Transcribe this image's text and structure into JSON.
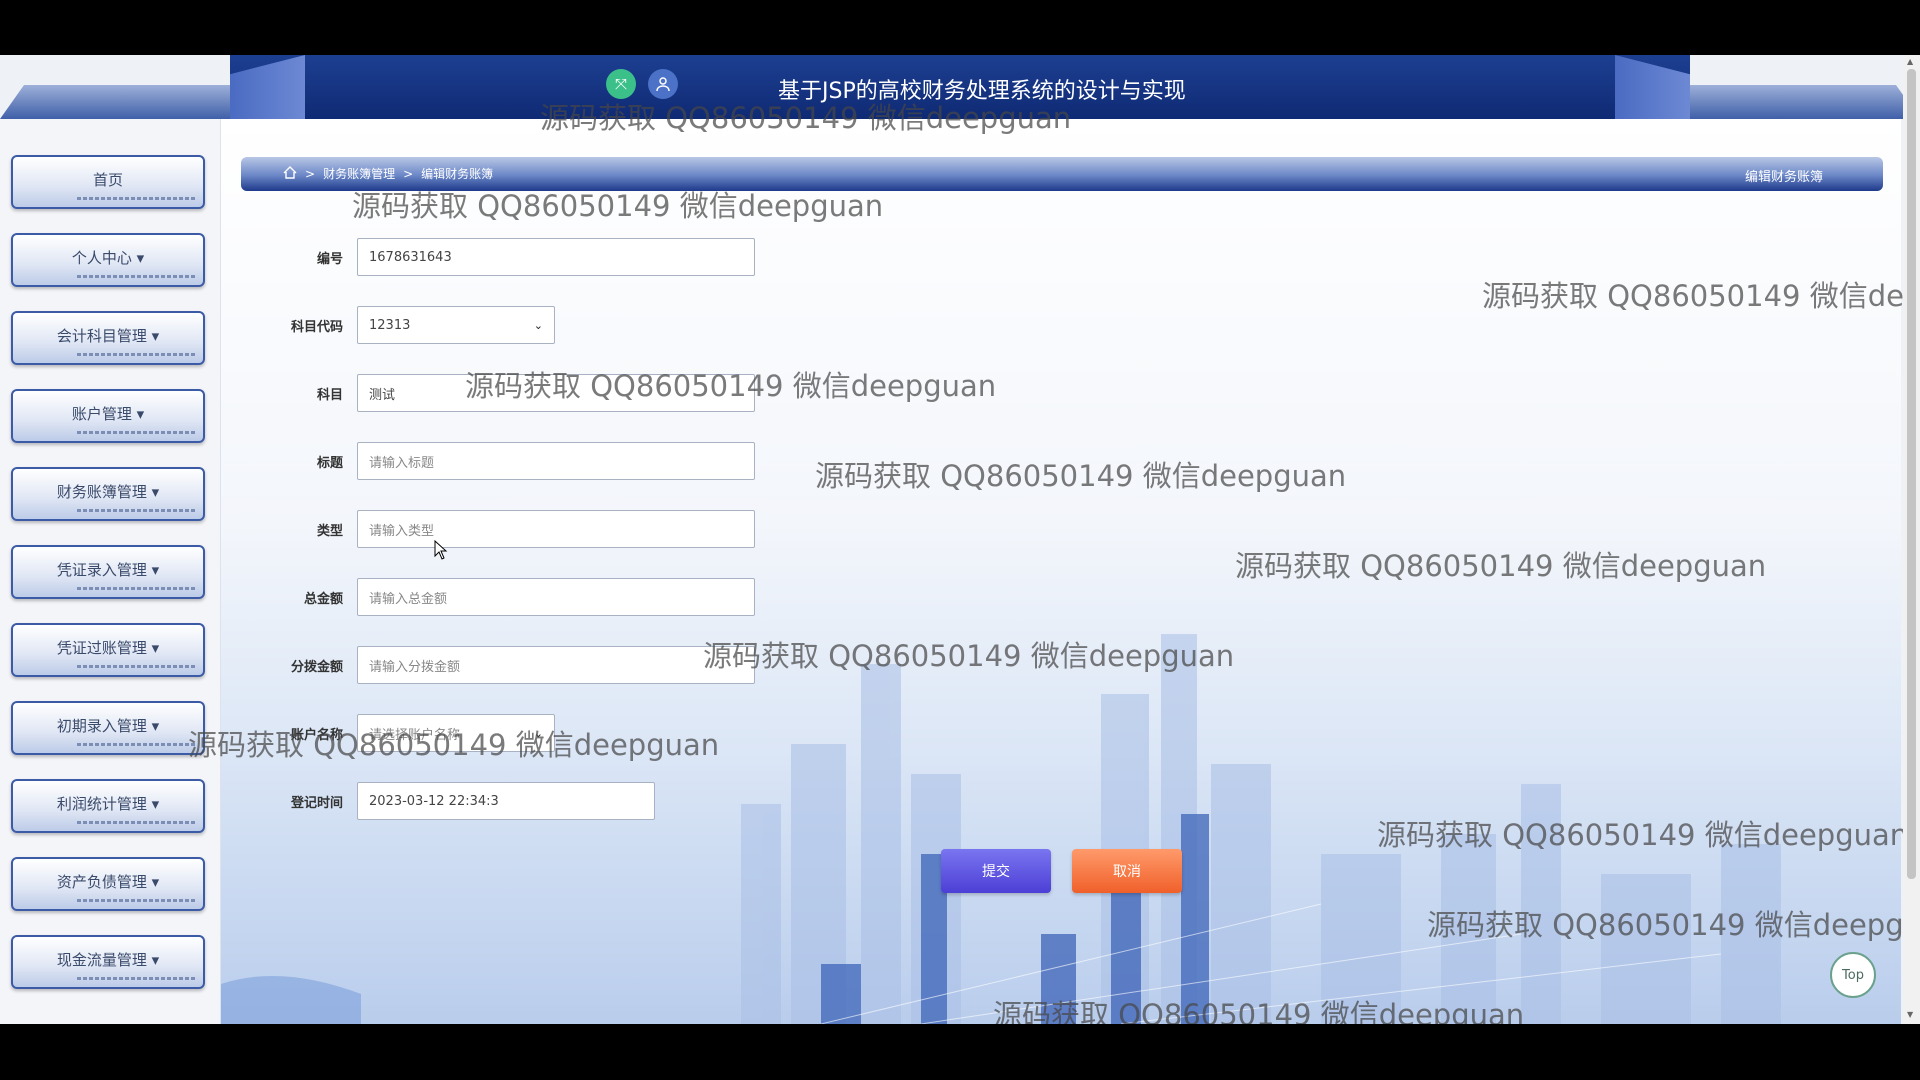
{
  "header": {
    "title": "基于JSP的高校财务处理系统的设计与实现"
  },
  "icons": {
    "fullscreen": "expand-arrows-icon",
    "user": "user-icon",
    "home": "home-icon"
  },
  "sidebar": {
    "items": [
      {
        "label": "首页"
      },
      {
        "label": "个人中心 ▾"
      },
      {
        "label": "会计科目管理 ▾"
      },
      {
        "label": "账户管理 ▾"
      },
      {
        "label": "财务账簿管理 ▾"
      },
      {
        "label": "凭证录入管理 ▾"
      },
      {
        "label": "凭证过账管理 ▾"
      },
      {
        "label": "初期录入管理 ▾"
      },
      {
        "label": "利润统计管理 ▾"
      },
      {
        "label": "资产负债管理 ▾"
      },
      {
        "label": "现金流量管理 ▾"
      }
    ]
  },
  "breadcrumb": {
    "sep": ">",
    "level1": "财务账簿管理",
    "level2": "编辑财务账簿",
    "right_title": "编辑财务账簿"
  },
  "form": {
    "id": {
      "label": "编号",
      "value": "1678631643"
    },
    "subject_code": {
      "label": "科目代码",
      "value": "12313"
    },
    "subject": {
      "label": "科目",
      "value": "测试"
    },
    "title": {
      "label": "标题",
      "placeholder": "请输入标题"
    },
    "type": {
      "label": "类型",
      "placeholder": "请输入类型"
    },
    "total": {
      "label": "总金额",
      "placeholder": "请输入总金额"
    },
    "allocated": {
      "label": "分拨金额",
      "placeholder": "请输入分拨金额"
    },
    "account_name": {
      "label": "账户名称",
      "placeholder": "请选择账户名称"
    },
    "reg_time": {
      "label": "登记时间",
      "value": "2023-03-12 22:34:3"
    }
  },
  "buttons": {
    "submit": "提交",
    "cancel": "取消",
    "top": "Top"
  },
  "watermark": "源码获取 QQ86050149 微信deepguan",
  "colors": {
    "header": "#1d3f91",
    "submit": "#4c3fd6",
    "cancel": "#f0602a"
  }
}
